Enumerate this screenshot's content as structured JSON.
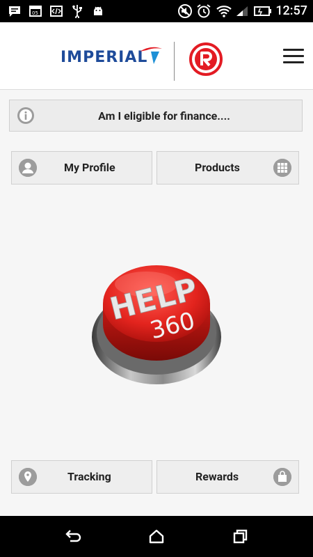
{
  "status_bar": {
    "time": "12:57",
    "icons": [
      "message-icon",
      "calendar-icon",
      "code-icon",
      "usb-icon",
      "android-icon",
      "mute-icon",
      "alarm-icon",
      "wifi-icon",
      "signal-icon",
      "battery-icon"
    ]
  },
  "header": {
    "brand_left": "IMPERIAL",
    "menu_icon": "hamburger-menu-icon"
  },
  "banner": {
    "text": "Am I eligible for finance....",
    "icon": "info-icon"
  },
  "tiles": {
    "my_profile": {
      "label": "My Profile",
      "icon": "person-icon"
    },
    "products": {
      "label": "Products",
      "icon": "grid-icon"
    },
    "tracking": {
      "label": "Tracking",
      "icon": "location-pin-icon"
    },
    "rewards": {
      "label": "Rewards",
      "icon": "shopping-bag-icon"
    }
  },
  "help_button": {
    "line1": "HELP",
    "line2": "360"
  },
  "nav_bar": {
    "icons": [
      "back-icon",
      "home-icon",
      "recent-apps-icon"
    ]
  },
  "colors": {
    "imperial_blue": "#1e4b9a",
    "brand_red": "#e31b23",
    "tile_bg": "#eeeeee",
    "page_bg": "#f6f6f6"
  }
}
